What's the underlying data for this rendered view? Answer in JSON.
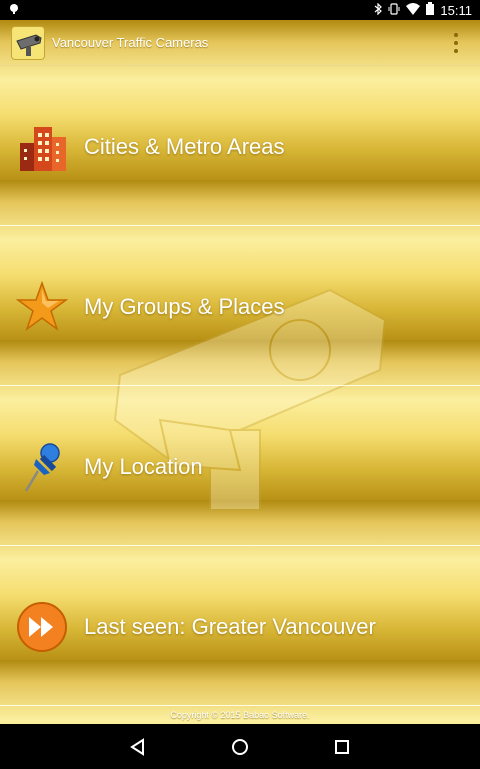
{
  "status_bar": {
    "time": "15:11"
  },
  "app_bar": {
    "title": "Vancouver Traffic Cameras"
  },
  "menu": {
    "items": [
      {
        "label": "Cities & Metro Areas",
        "icon": "buildings-icon"
      },
      {
        "label": "My Groups & Places",
        "icon": "star-icon"
      },
      {
        "label": "My Location",
        "icon": "pushpin-icon"
      },
      {
        "label": "Last seen: Greater Vancouver",
        "icon": "fast-forward-icon"
      }
    ]
  },
  "footer": {
    "copyright": "Copyright © 2015 Babao Software."
  },
  "colors": {
    "gold_light": "#fbef9e",
    "gold_dark": "#b08a10"
  }
}
